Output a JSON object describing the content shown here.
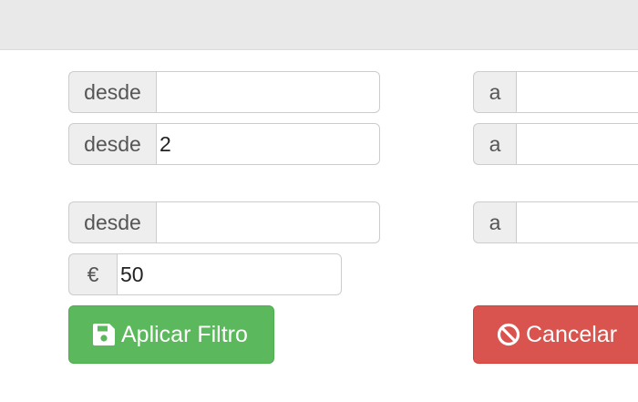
{
  "filters": {
    "row1": {
      "from_label": "desde",
      "from_value": "",
      "to_label": "a",
      "to_value": ""
    },
    "row2": {
      "from_label": "desde",
      "from_value": "2",
      "to_label": "a",
      "to_value": ""
    },
    "row3": {
      "from_label": "desde",
      "from_value": "",
      "to_label": "a",
      "to_value": ""
    },
    "price": {
      "currency_symbol": "€",
      "value": "50"
    }
  },
  "buttons": {
    "apply": {
      "label": "Aplicar Filtro",
      "icon": "floppy-disk-icon",
      "color": "#5cb85c"
    },
    "cancel": {
      "label": "Cancelar",
      "icon": "ban-icon",
      "color": "#d9534f"
    }
  }
}
